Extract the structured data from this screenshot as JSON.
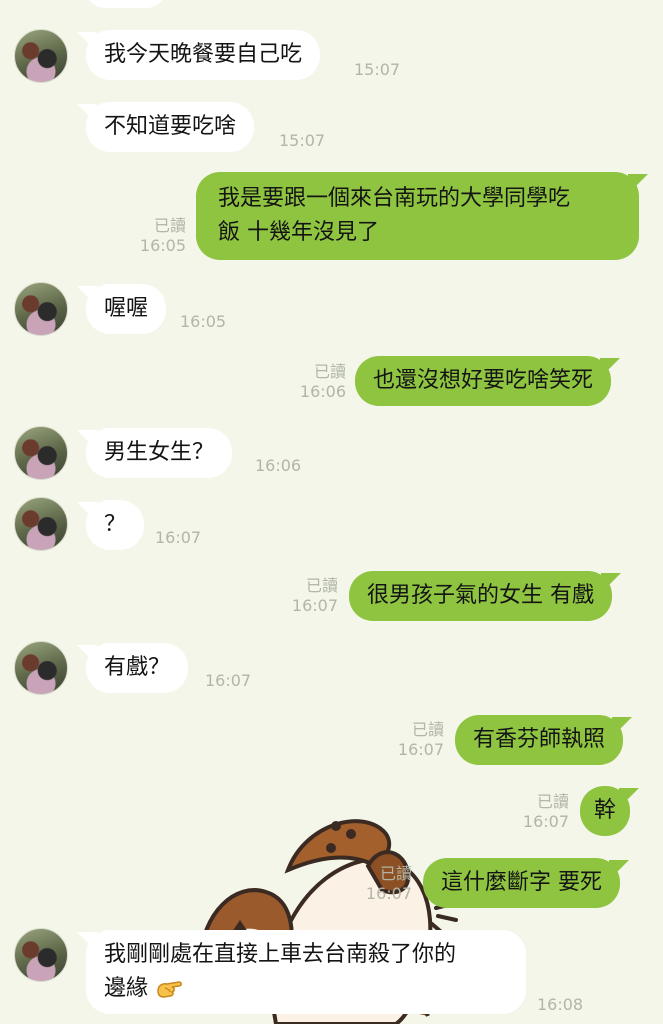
{
  "messages": [
    {
      "dir": "in",
      "text": "我今天晚餐要自己吃",
      "time": "15:07"
    },
    {
      "dir": "in",
      "text": "不知道要吃啥",
      "time": "15:07"
    },
    {
      "dir": "out",
      "line1": "我是要跟一個來台南玩的大學同學吃",
      "line2": "飯 十幾年沒見了",
      "read": "已讀",
      "time": "16:05"
    },
    {
      "dir": "in",
      "text": "喔喔",
      "time": "16:05"
    },
    {
      "dir": "out",
      "text": "也還沒想好要吃啥笑死",
      "read": "已讀",
      "time": "16:06"
    },
    {
      "dir": "in",
      "text": "男生女生？",
      "time": "16:06"
    },
    {
      "dir": "in",
      "text": "？",
      "time": "16:07"
    },
    {
      "dir": "out",
      "text": "很男孩子氣的女生 有戲",
      "read": "已讀",
      "time": "16:07"
    },
    {
      "dir": "in",
      "text": "有戲？",
      "time": "16:07"
    },
    {
      "dir": "out",
      "text": "有香芬師執照",
      "read": "已讀",
      "time": "16:07"
    },
    {
      "dir": "out",
      "text": "幹",
      "read": "已讀",
      "time": "16:07"
    },
    {
      "dir": "out",
      "text": "這什麼斷字 要死",
      "read": "已讀",
      "time": "16:07"
    },
    {
      "dir": "in",
      "line1": "我剛剛處在直接上車去台南殺了你的",
      "line2": "邊緣",
      "emoji": "pointing-hand-emoji",
      "time": "16:08"
    }
  ],
  "sticker": {
    "name": "sparrow-sticker",
    "colors": {
      "brown": "#9a5a2c",
      "cream": "#fbf1e4",
      "dark": "#4a3a33"
    }
  },
  "colors": {
    "background": "#f3f6e9",
    "incoming": "#ffffff",
    "outgoing": "#8fc440",
    "meta": "#b1b6a8"
  }
}
